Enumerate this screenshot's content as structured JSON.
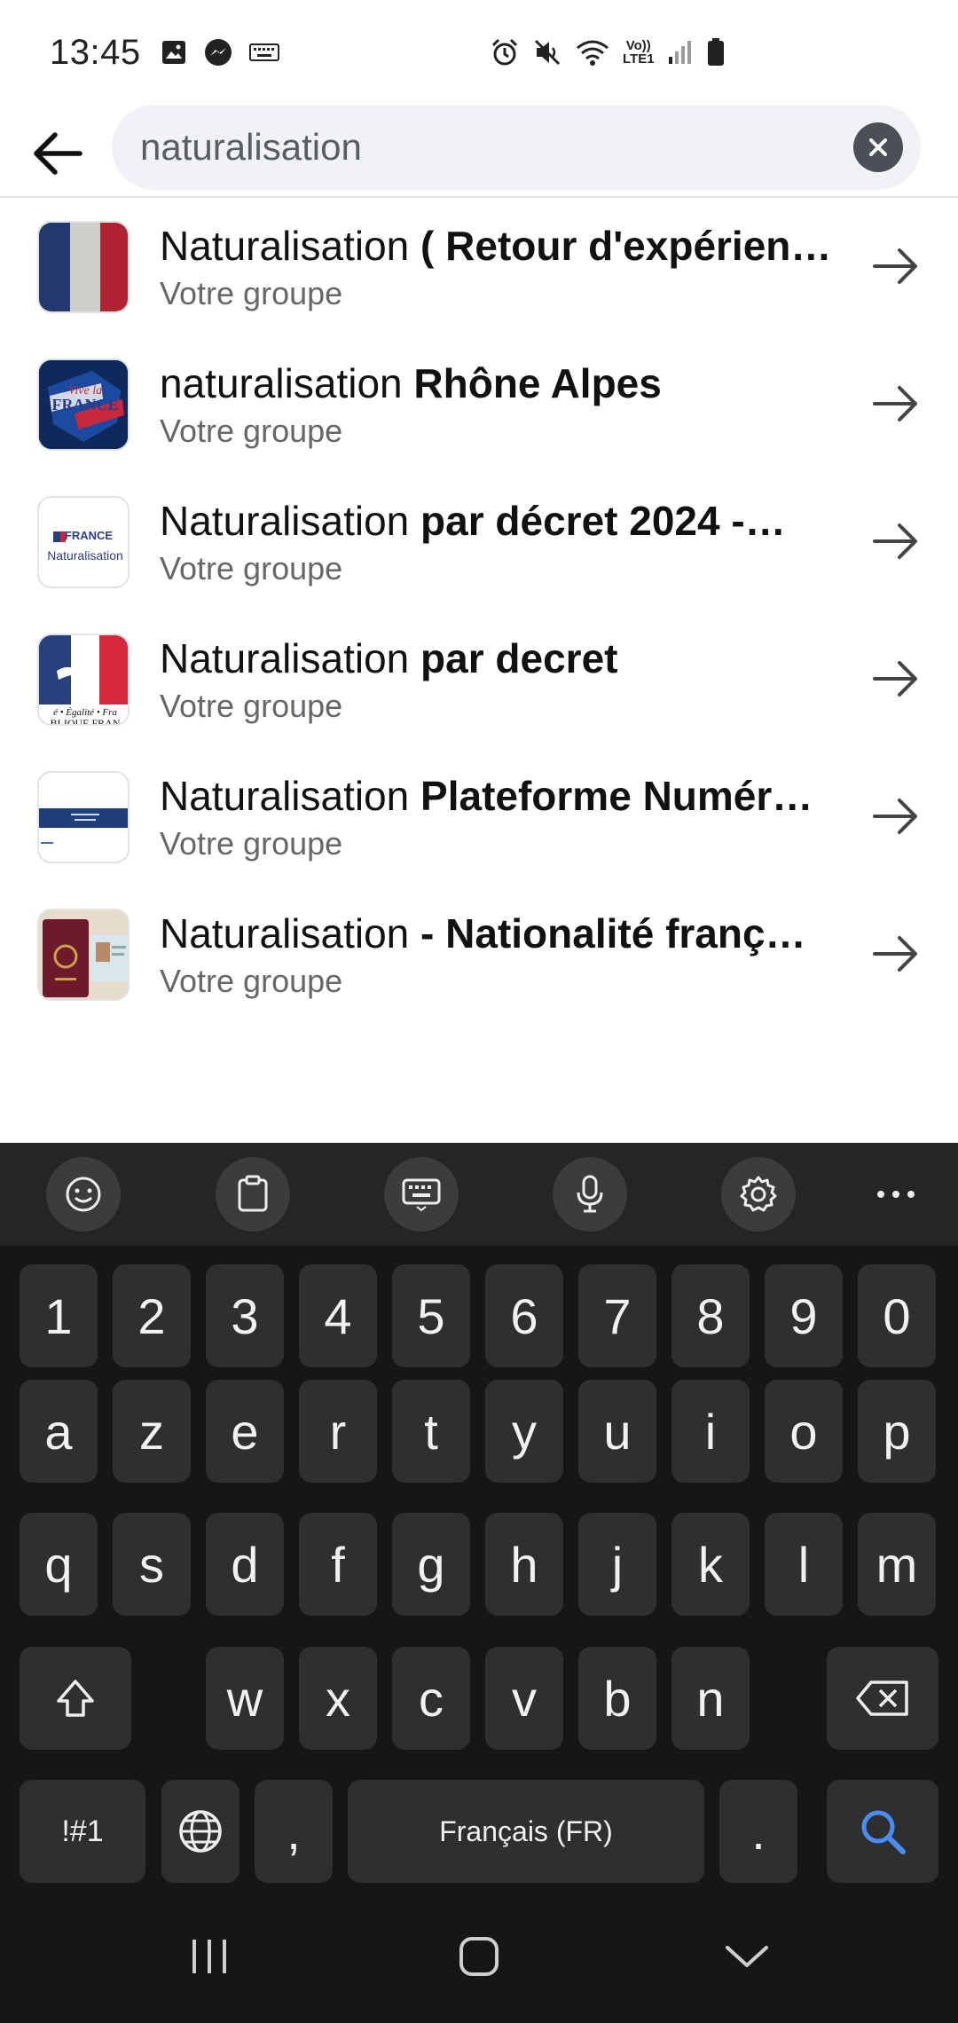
{
  "status_bar": {
    "time": "13:45",
    "left_icons": [
      "gallery-icon",
      "messenger-icon",
      "keyboard-icon"
    ],
    "right_icons": [
      "alarm-icon",
      "mute-icon",
      "wifi-icon",
      "volte-icon",
      "signal-icon",
      "battery-icon"
    ],
    "volte_label_top": "Vo))",
    "volte_label_bottom": "LTE1"
  },
  "search": {
    "query": "naturalisation",
    "back_icon": "back-arrow-icon",
    "clear_icon": "clear-icon"
  },
  "results": [
    {
      "title_plain": "Naturalisation ",
      "title_bold": "( Retour d'expérien…",
      "subtitle": "Votre groupe",
      "thumb": "french-flag"
    },
    {
      "title_plain": "naturalisation ",
      "title_bold": "Rhône Alpes",
      "subtitle": "Votre groupe",
      "thumb": "vive-la-france",
      "thumb_text": "Vive la FRANCE"
    },
    {
      "title_plain": "Naturalisation ",
      "title_bold": "par décret 2024 -…",
      "subtitle": "Votre groupe",
      "thumb": "france-naturalisation",
      "thumb_text_top": "FRANCE",
      "thumb_text_bottom": "Naturalisation"
    },
    {
      "title_plain": "Naturalisation ",
      "title_bold": "par decret",
      "subtitle": "Votre groupe",
      "thumb": "marianne",
      "thumb_text_top": "é • Égalité • Fra",
      "thumb_text_bottom": "BLIQUE FRAN"
    },
    {
      "title_plain": "Naturalisation ",
      "title_bold": "Plateforme Numér…",
      "subtitle": "Votre groupe",
      "thumb": "blue-band"
    },
    {
      "title_plain": "Naturalisation ",
      "title_bold": "- Nationalité franç…",
      "subtitle": "Votre groupe",
      "thumb": "passport"
    }
  ],
  "keyboard": {
    "toolbar": [
      "emoji-icon",
      "clipboard-icon",
      "keyboard-mode-icon",
      "microphone-icon",
      "settings-icon",
      "more-icon"
    ],
    "row_numbers": [
      "1",
      "2",
      "3",
      "4",
      "5",
      "6",
      "7",
      "8",
      "9",
      "0"
    ],
    "row1": [
      "a",
      "z",
      "e",
      "r",
      "t",
      "y",
      "u",
      "i",
      "o",
      "p"
    ],
    "row2": [
      "q",
      "s",
      "d",
      "f",
      "g",
      "h",
      "j",
      "k",
      "l",
      "m"
    ],
    "row3": [
      "w",
      "x",
      "c",
      "v",
      "b",
      "n"
    ],
    "symbols_label": "!#1",
    "comma": ",",
    "space_label": "Français (FR)",
    "period": ".",
    "search_color": "#4a8cf7"
  },
  "nav_bar": [
    "recents-icon",
    "home-icon",
    "hide-keyboard-icon"
  ]
}
